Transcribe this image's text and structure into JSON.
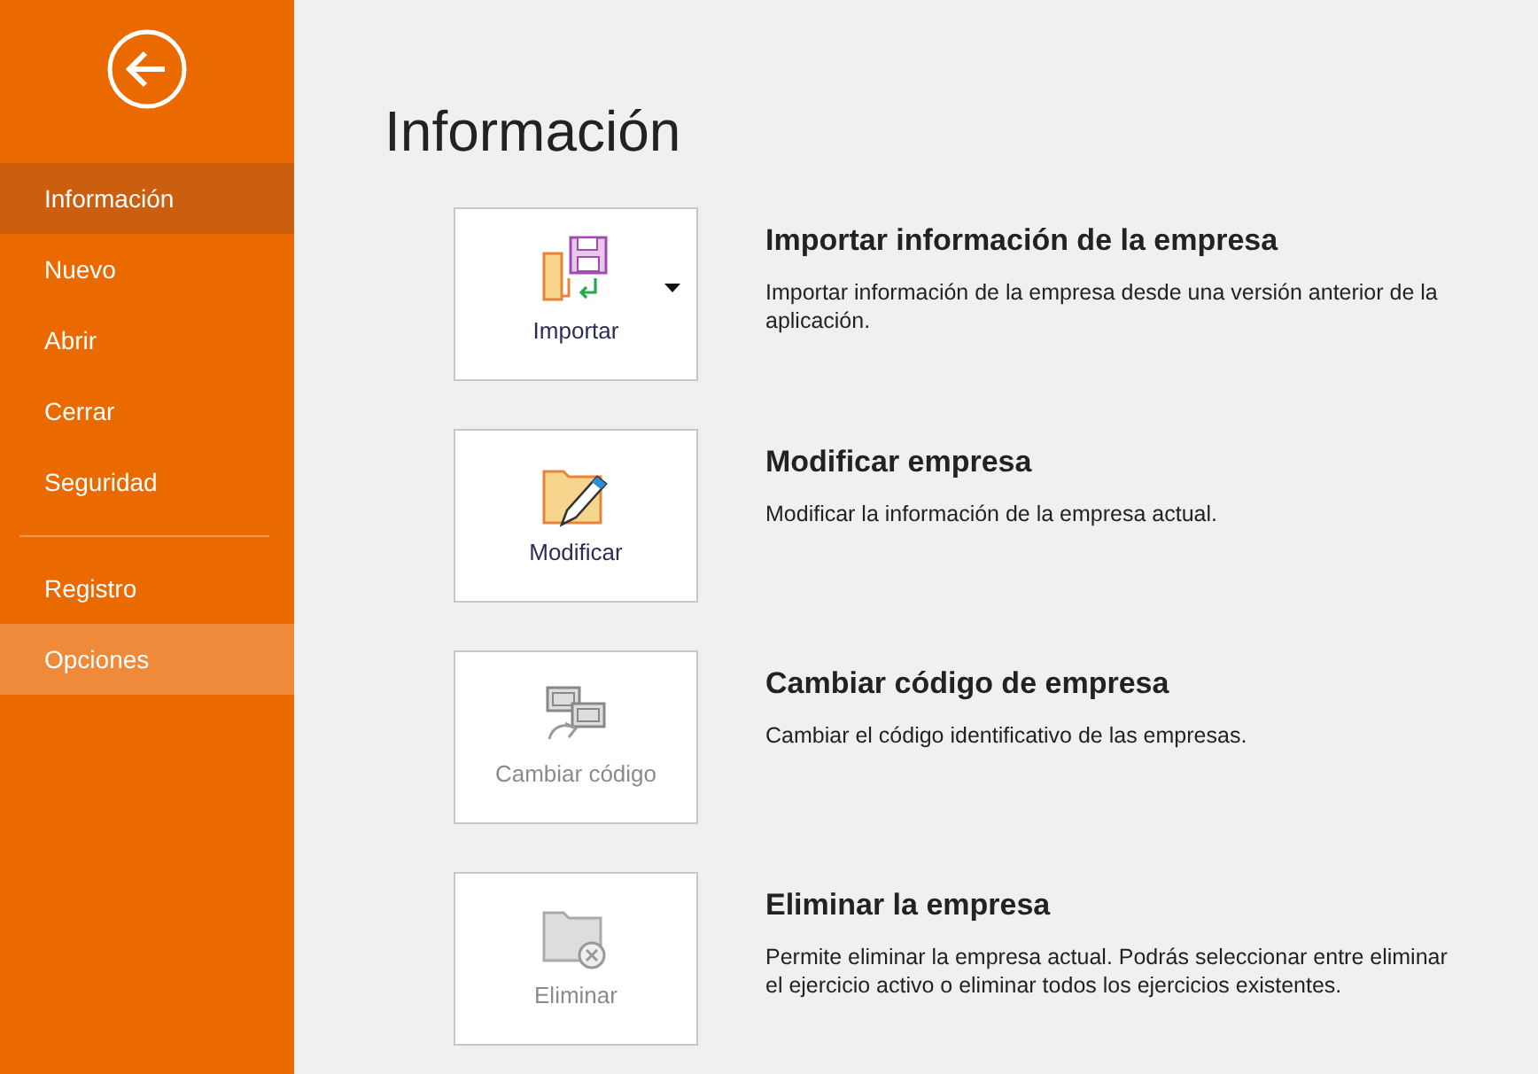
{
  "sidebar": {
    "items": [
      {
        "label": "Información",
        "selected": true,
        "hovered": false,
        "divider_before": false
      },
      {
        "label": "Nuevo",
        "selected": false,
        "hovered": false,
        "divider_before": false
      },
      {
        "label": "Abrir",
        "selected": false,
        "hovered": false,
        "divider_before": false
      },
      {
        "label": "Cerrar",
        "selected": false,
        "hovered": false,
        "divider_before": false
      },
      {
        "label": "Seguridad",
        "selected": false,
        "hovered": false,
        "divider_before": false
      },
      {
        "label": "Registro",
        "selected": false,
        "hovered": false,
        "divider_before": true
      },
      {
        "label": "Opciones",
        "selected": false,
        "hovered": true,
        "divider_before": false
      }
    ]
  },
  "page_title": "Información",
  "actions": [
    {
      "kind": "import",
      "button": "Importar",
      "dropdown": true,
      "disabled": false,
      "title": "Importar información de la empresa",
      "description": "Importar información de la empresa desde una versión anterior de la aplicación."
    },
    {
      "kind": "edit",
      "button": "Modificar",
      "dropdown": false,
      "disabled": false,
      "title": "Modificar empresa",
      "description": "Modificar la información de la empresa actual."
    },
    {
      "kind": "code",
      "button": "Cambiar código",
      "dropdown": false,
      "disabled": true,
      "title": "Cambiar código de empresa",
      "description": "Cambiar el código identificativo de las empresas."
    },
    {
      "kind": "delete",
      "button": "Eliminar",
      "dropdown": false,
      "disabled": true,
      "title": "Eliminar la empresa",
      "description": "Permite eliminar la empresa actual. Podrás seleccionar entre eliminar el ejercicio activo o eliminar todos los ejercicios existentes."
    }
  ]
}
